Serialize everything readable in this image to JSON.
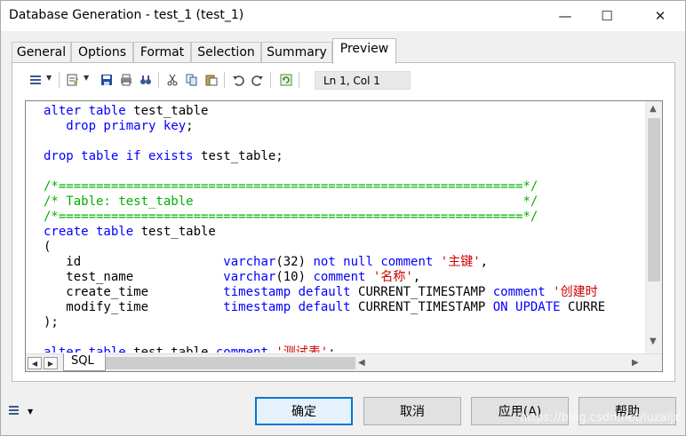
{
  "window": {
    "title": "Database Generation - test_1 (test_1)",
    "minimize_glyph": "—",
    "maximize_glyph": "☐",
    "close_glyph": "✕"
  },
  "tabs": [
    {
      "label": "General"
    },
    {
      "label": "Options"
    },
    {
      "label": "Format"
    },
    {
      "label": "Selection"
    },
    {
      "label": "Summary"
    },
    {
      "label": "Preview",
      "active": true
    }
  ],
  "toolbar": {
    "cursor_position": "Ln 1, Col 1",
    "icons": [
      "script-menu-icon",
      "edit-menu-icon",
      "save-icon",
      "print-icon",
      "find-icon",
      "cut-icon",
      "copy-icon",
      "paste-icon",
      "undo-icon",
      "redo-icon",
      "refresh-icon"
    ]
  },
  "code_colors": {
    "keyword": "#0000ff",
    "comment": "#00b000",
    "string": "#cc0000",
    "default": "#000000"
  },
  "code_lines": [
    [
      {
        "t": "alter table ",
        "c": "keyword"
      },
      {
        "t": "test_table",
        "c": "default"
      }
    ],
    [
      {
        "t": "   drop primary key",
        "c": "keyword"
      },
      {
        "t": ";",
        "c": "default"
      }
    ],
    [],
    [
      {
        "t": "drop table if exists ",
        "c": "keyword"
      },
      {
        "t": "test_table;",
        "c": "default"
      }
    ],
    [],
    [
      {
        "t": "/*==============================================================*/",
        "c": "comment"
      }
    ],
    [
      {
        "t": "/* Table: test_table                                            */",
        "c": "comment"
      }
    ],
    [
      {
        "t": "/*==============================================================*/",
        "c": "comment"
      }
    ],
    [
      {
        "t": "create table ",
        "c": "keyword"
      },
      {
        "t": "test_table",
        "c": "default"
      }
    ],
    [
      {
        "t": "(",
        "c": "default"
      }
    ],
    [
      {
        "t": "   id                   ",
        "c": "default"
      },
      {
        "t": "varchar",
        "c": "keyword"
      },
      {
        "t": "(32) ",
        "c": "default"
      },
      {
        "t": "not null comment ",
        "c": "keyword"
      },
      {
        "t": "'主键'",
        "c": "string"
      },
      {
        "t": ",",
        "c": "default"
      }
    ],
    [
      {
        "t": "   test_name            ",
        "c": "default"
      },
      {
        "t": "varchar",
        "c": "keyword"
      },
      {
        "t": "(10) ",
        "c": "default"
      },
      {
        "t": "comment ",
        "c": "keyword"
      },
      {
        "t": "'名称'",
        "c": "string"
      },
      {
        "t": ",",
        "c": "default"
      }
    ],
    [
      {
        "t": "   create_time          ",
        "c": "default"
      },
      {
        "t": "timestamp default ",
        "c": "keyword"
      },
      {
        "t": "CURRENT_TIMESTAMP ",
        "c": "default"
      },
      {
        "t": "comment ",
        "c": "keyword"
      },
      {
        "t": "'创建时",
        "c": "string"
      }
    ],
    [
      {
        "t": "   modify_time          ",
        "c": "default"
      },
      {
        "t": "timestamp default ",
        "c": "keyword"
      },
      {
        "t": "CURRENT_TIMESTAMP ",
        "c": "default"
      },
      {
        "t": "ON UPDATE ",
        "c": "keyword"
      },
      {
        "t": "CURRE",
        "c": "default"
      }
    ],
    [
      {
        "t": ");",
        "c": "default"
      }
    ],
    [],
    [
      {
        "t": "alter table ",
        "c": "keyword"
      },
      {
        "t": "test_table ",
        "c": "default"
      },
      {
        "t": "comment ",
        "c": "keyword"
      },
      {
        "t": "'测试表'",
        "c": "string"
      },
      {
        "t": ";",
        "c": "default"
      }
    ]
  ],
  "editor_tab": {
    "label": "SQL"
  },
  "buttons": {
    "ok": "确定",
    "cancel": "取消",
    "apply": "应用(A)",
    "help": "帮助"
  },
  "watermark": "https://blog.csdn.net/luzaijx"
}
